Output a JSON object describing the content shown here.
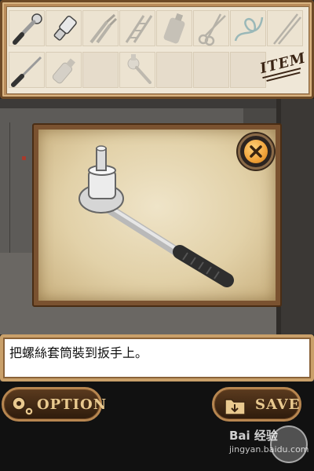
{
  "inventory": {
    "stamp": "ITEM",
    "items": [
      {
        "icon": "ratchet-wrench-icon",
        "state": "active"
      },
      {
        "icon": "socket-icon",
        "state": "active"
      },
      {
        "icon": "pliers-icon",
        "state": "faded"
      },
      {
        "icon": "ladder-icon",
        "state": "faded"
      },
      {
        "icon": "canister-icon",
        "state": "faded"
      },
      {
        "icon": "scissors-icon",
        "state": "faded"
      },
      {
        "icon": "cable-icon",
        "state": "faded"
      },
      {
        "icon": "rods-icon",
        "state": "faded"
      },
      {
        "icon": "screwdriver-icon",
        "state": "active"
      },
      {
        "icon": "bottle-icon",
        "state": "faded"
      },
      {
        "icon": "empty-slot",
        "state": "empty"
      },
      {
        "icon": "wrench-socket-icon",
        "state": "faded"
      },
      {
        "icon": "empty-slot",
        "state": "empty"
      },
      {
        "icon": "empty-slot",
        "state": "empty"
      }
    ]
  },
  "viewer": {
    "item_icon": "wrench-with-socket-icon",
    "close_icon": "close-x-icon"
  },
  "message": {
    "text": "把螺絲套筒裝到扳手上。"
  },
  "buttons": {
    "option_label": "OPTION",
    "save_label": "SAVE",
    "option_icon": "gears-icon",
    "save_icon": "folder-arrow-icon"
  },
  "watermark": {
    "logo": "Bai 经验",
    "url": "jingyan.baidu.com"
  },
  "colors": {
    "frame": "#b98b5a",
    "accent_orange": "#f0a23a",
    "button_text": "#e9c98f"
  }
}
